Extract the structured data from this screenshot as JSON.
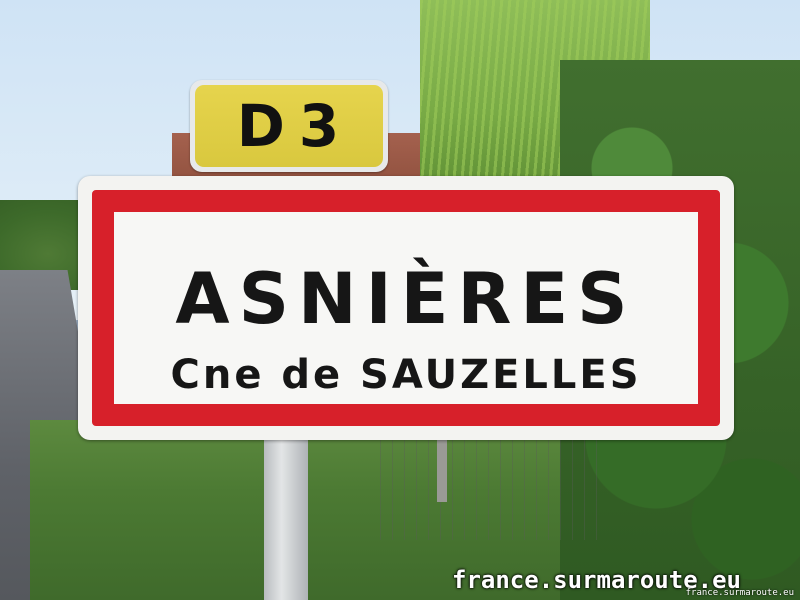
{
  "road_sign": {
    "text": "D3",
    "bg_color": "#ddd040"
  },
  "town_sign": {
    "name": "ASNIÈRES",
    "commune": "Cne de SAUZELLES",
    "border_color": "#d7202a"
  },
  "watermark": {
    "main": "france.surmaroute.eu",
    "small": "france.surmaroute.eu"
  }
}
